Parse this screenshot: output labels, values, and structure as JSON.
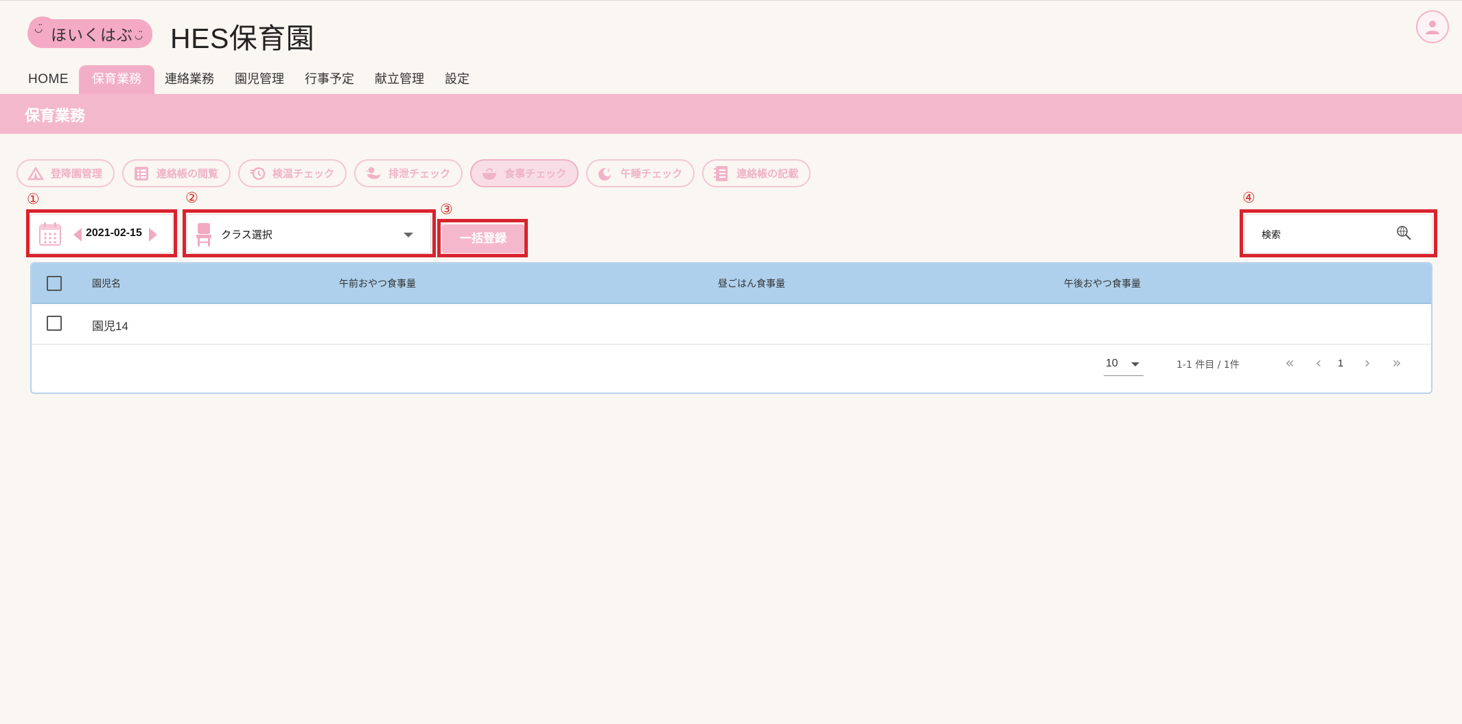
{
  "header": {
    "logo_text": "ほいくはぶ",
    "site_title": "HES保育園"
  },
  "nav": {
    "items": [
      {
        "label": "HOME"
      },
      {
        "label": "保育業務"
      },
      {
        "label": "連絡業務"
      },
      {
        "label": "園児管理"
      },
      {
        "label": "行事予定"
      },
      {
        "label": "献立管理"
      },
      {
        "label": "設定"
      }
    ],
    "active_index": 1
  },
  "banner": {
    "title": "保育業務"
  },
  "subtabs": [
    {
      "label": "登降園管理",
      "icon": "tent-icon"
    },
    {
      "label": "連絡帳の閲覧",
      "icon": "list-icon"
    },
    {
      "label": "検温チェック",
      "icon": "thermometer-icon"
    },
    {
      "label": "排泄チェック",
      "icon": "duck-icon"
    },
    {
      "label": "食事チェック",
      "icon": "bowl-icon",
      "active": true
    },
    {
      "label": "午睡チェック",
      "icon": "moon-icon"
    },
    {
      "label": "連絡帳の記載",
      "icon": "notebook-icon"
    }
  ],
  "markers": {
    "m1": "①",
    "m2": "②",
    "m3": "③",
    "m4": "④"
  },
  "toolbar": {
    "date": "2021-02-15",
    "class_select_placeholder": "クラス選択",
    "bulk_register_label": "一括登録",
    "search_placeholder": "検索"
  },
  "table": {
    "columns": [
      "園児名",
      "午前おやつ食事量",
      "昼ごはん食事量",
      "午後おやつ食事量"
    ],
    "rows": [
      {
        "name": "園児14",
        "am_snack": "",
        "lunch": "",
        "pm_snack": ""
      }
    ]
  },
  "pagination": {
    "per_page": "10",
    "range": "1-1 件目 / 1件",
    "current_page": "1"
  },
  "colors": {
    "accent_pink": "#f3aec7",
    "banner_pink": "#f4b8cc",
    "table_header_blue": "#aed0ec",
    "annotation_red": "#d9232e"
  }
}
